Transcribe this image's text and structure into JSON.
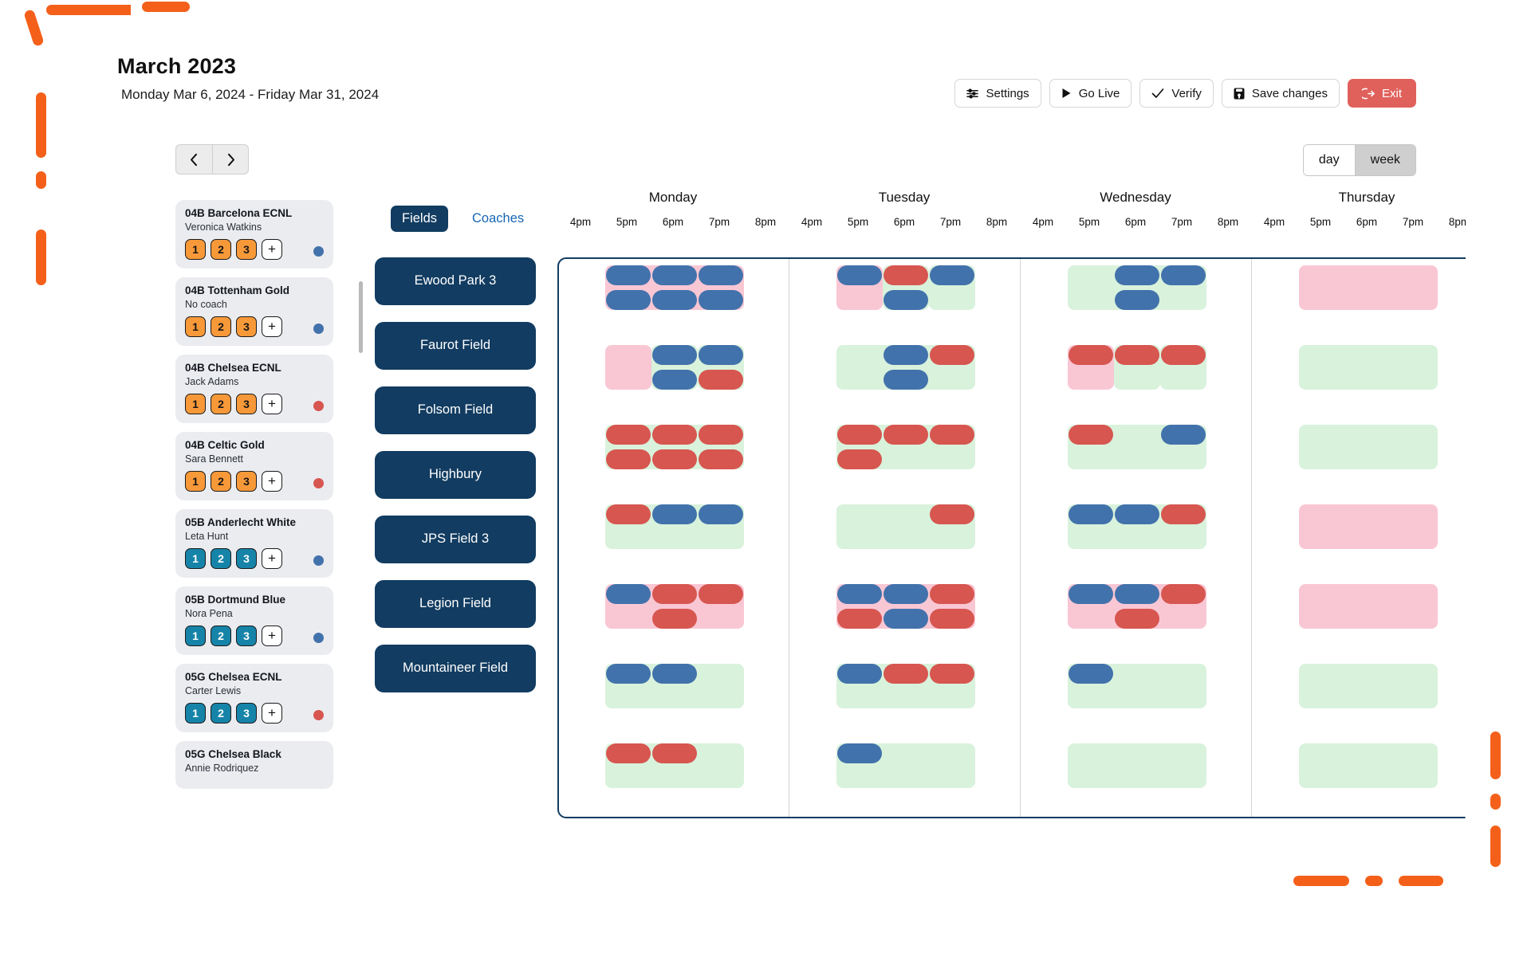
{
  "header": {
    "title": "March 2023",
    "date_range": "Monday Mar 6, 2024 - Friday Mar 31, 2024",
    "prev_icon": "chevron-left-icon",
    "next_icon": "chevron-right-icon"
  },
  "toolbar": {
    "settings_label": "Settings",
    "go_live_label": "Go Live",
    "verify_label": "Verify",
    "save_label": "Save changes",
    "exit_label": "Exit",
    "exit_color": "#e0615c"
  },
  "view_toggle": {
    "day_label": "day",
    "week_label": "week",
    "active": "week"
  },
  "panel_tabs": {
    "fields_label": "Fields",
    "coaches_label": "Coaches",
    "active": "Fields",
    "active_color": "#123c61",
    "link_color": "#1766b4"
  },
  "teams": [
    {
      "name": "04B Barcelona ECNL",
      "coach": "Veronica Watkins",
      "badges": [
        "1",
        "2",
        "3"
      ],
      "add_label": "+",
      "badge_style": "orange",
      "dot_color": "#4272ab"
    },
    {
      "name": "04B Tottenham Gold",
      "coach": "No coach",
      "badges": [
        "1",
        "2",
        "3"
      ],
      "add_label": "+",
      "badge_style": "orange",
      "dot_color": "#4272ab"
    },
    {
      "name": "04B Chelsea ECNL",
      "coach": "Jack Adams",
      "badges": [
        "1",
        "2",
        "3"
      ],
      "add_label": "+",
      "badge_style": "orange",
      "dot_color": "#d75650"
    },
    {
      "name": "04B Celtic Gold",
      "coach": "Sara Bennett",
      "badges": [
        "1",
        "2",
        "3"
      ],
      "add_label": "+",
      "badge_style": "orange",
      "dot_color": "#d75650"
    },
    {
      "name": "05B Anderlecht White",
      "coach": "Leta Hunt",
      "badges": [
        "1",
        "2",
        "3"
      ],
      "add_label": "+",
      "badge_style": "teal",
      "dot_color": "#4272ab"
    },
    {
      "name": "05B Dortmund Blue",
      "coach": "Nora Pena",
      "badges": [
        "1",
        "2",
        "3"
      ],
      "add_label": "+",
      "badge_style": "teal",
      "dot_color": "#4272ab"
    },
    {
      "name": "05G Chelsea ECNL",
      "coach": "Carter Lewis",
      "badges": [
        "1",
        "2",
        "3"
      ],
      "add_label": "+",
      "badge_style": "teal",
      "dot_color": "#d75650"
    },
    {
      "name": "05G Chelsea Black",
      "coach": "Annie Rodriquez",
      "badges": [],
      "add_label": "+",
      "badge_style": "teal",
      "dot_color": ""
    }
  ],
  "fields": [
    {
      "label": "Ewood Park 3"
    },
    {
      "label": "Faurot Field"
    },
    {
      "label": "Folsom Field"
    },
    {
      "label": "Highbury"
    },
    {
      "label": "JPS Field 3"
    },
    {
      "label": "Legion Field"
    },
    {
      "label": "Mountaineer Field"
    }
  ],
  "calendar": {
    "days": [
      "Monday",
      "Tuesday",
      "Wednesday",
      "Thursday"
    ],
    "hours": [
      "4pm",
      "5pm",
      "6pm",
      "7pm",
      "8pm"
    ],
    "border_color": "#123c61",
    "band_green": "#d9f2dc",
    "band_pink": "#f9c7d4",
    "event_blue": "#4272ab",
    "event_red": "#d75650",
    "rows": [
      {
        "field": "Ewood Park 3",
        "cells": [
          {
            "day": "Monday",
            "band": "pink",
            "start": 1,
            "span": 3,
            "events": [
              {
                "c": 0,
                "half": "top",
                "color": "blue"
              },
              {
                "c": 0,
                "half": "bottom",
                "color": "blue"
              },
              {
                "c": 1,
                "half": "top",
                "color": "blue"
              },
              {
                "c": 1,
                "half": "bottom",
                "color": "blue"
              },
              {
                "c": 2,
                "half": "top",
                "color": "blue"
              },
              {
                "c": 2,
                "half": "bottom",
                "color": "blue"
              }
            ]
          },
          {
            "day": "Tuesday",
            "band": "mixed",
            "start": 1,
            "span": 3,
            "bandsegs": [
              {
                "c": 0,
                "color": "pink"
              },
              {
                "c": 1,
                "color": "green"
              },
              {
                "c": 2,
                "color": "green"
              }
            ],
            "events": [
              {
                "c": 0,
                "half": "top",
                "color": "blue"
              },
              {
                "c": 1,
                "half": "top",
                "color": "red"
              },
              {
                "c": 1,
                "half": "bottom",
                "color": "blue"
              },
              {
                "c": 2,
                "half": "top",
                "color": "blue"
              }
            ]
          },
          {
            "day": "Wednesday",
            "band": "green",
            "start": 1,
            "span": 3,
            "events": [
              {
                "c": 1,
                "half": "top",
                "color": "blue"
              },
              {
                "c": 1,
                "half": "bottom",
                "color": "blue"
              },
              {
                "c": 2,
                "half": "top",
                "color": "blue"
              }
            ]
          },
          {
            "day": "Thursday",
            "band": "pink",
            "start": 1,
            "span": 3,
            "events": []
          }
        ]
      },
      {
        "field": "Faurot Field",
        "cells": [
          {
            "day": "Monday",
            "band": "mixed",
            "start": 1,
            "span": 3,
            "bandsegs": [
              {
                "c": 0,
                "color": "pink"
              },
              {
                "c": 1,
                "color": "green"
              },
              {
                "c": 2,
                "color": "green"
              }
            ],
            "events": [
              {
                "c": 1,
                "half": "top",
                "color": "blue"
              },
              {
                "c": 1,
                "half": "bottom",
                "color": "blue"
              },
              {
                "c": 2,
                "half": "top",
                "color": "blue"
              },
              {
                "c": 2,
                "half": "bottom",
                "color": "red"
              }
            ]
          },
          {
            "day": "Tuesday",
            "band": "green",
            "start": 1,
            "span": 3,
            "events": [
              {
                "c": 1,
                "half": "top",
                "color": "blue"
              },
              {
                "c": 1,
                "half": "bottom",
                "color": "blue"
              },
              {
                "c": 2,
                "half": "top",
                "color": "red"
              }
            ]
          },
          {
            "day": "Wednesday",
            "band": "mixed",
            "start": 1,
            "span": 3,
            "bandsegs": [
              {
                "c": 0,
                "color": "pink"
              },
              {
                "c": 1,
                "color": "green"
              },
              {
                "c": 2,
                "color": "green"
              }
            ],
            "events": [
              {
                "c": 0,
                "half": "top",
                "color": "red"
              },
              {
                "c": 1,
                "half": "top",
                "color": "red"
              },
              {
                "c": 2,
                "half": "top",
                "color": "red"
              }
            ]
          },
          {
            "day": "Thursday",
            "band": "green",
            "start": 1,
            "span": 3,
            "events": []
          }
        ]
      },
      {
        "field": "Folsom Field",
        "cells": [
          {
            "day": "Monday",
            "band": "green",
            "start": 1,
            "span": 3,
            "events": [
              {
                "c": 0,
                "half": "top",
                "color": "red"
              },
              {
                "c": 0,
                "half": "bottom",
                "color": "red"
              },
              {
                "c": 1,
                "half": "top",
                "color": "red"
              },
              {
                "c": 1,
                "half": "bottom",
                "color": "red"
              },
              {
                "c": 2,
                "half": "top",
                "color": "red"
              },
              {
                "c": 2,
                "half": "bottom",
                "color": "red"
              }
            ]
          },
          {
            "day": "Tuesday",
            "band": "green",
            "start": 1,
            "span": 3,
            "events": [
              {
                "c": 0,
                "half": "top",
                "color": "red"
              },
              {
                "c": 0,
                "half": "bottom",
                "color": "red"
              },
              {
                "c": 1,
                "half": "top",
                "color": "red"
              },
              {
                "c": 2,
                "half": "top",
                "color": "red"
              }
            ]
          },
          {
            "day": "Wednesday",
            "band": "green",
            "start": 1,
            "span": 3,
            "events": [
              {
                "c": 0,
                "half": "top",
                "color": "red"
              },
              {
                "c": 2,
                "half": "top",
                "color": "blue"
              }
            ]
          },
          {
            "day": "Thursday",
            "band": "green",
            "start": 1,
            "span": 3,
            "events": []
          }
        ]
      },
      {
        "field": "Highbury",
        "cells": [
          {
            "day": "Monday",
            "band": "green",
            "start": 1,
            "span": 3,
            "events": [
              {
                "c": 0,
                "half": "top",
                "color": "red"
              },
              {
                "c": 1,
                "half": "top",
                "color": "blue"
              },
              {
                "c": 2,
                "half": "top",
                "color": "blue"
              }
            ]
          },
          {
            "day": "Tuesday",
            "band": "green",
            "start": 1,
            "span": 3,
            "events": [
              {
                "c": 2,
                "half": "top",
                "color": "red"
              }
            ]
          },
          {
            "day": "Wednesday",
            "band": "green",
            "start": 1,
            "span": 3,
            "events": [
              {
                "c": 0,
                "half": "top",
                "color": "blue"
              },
              {
                "c": 1,
                "half": "top",
                "color": "blue"
              },
              {
                "c": 2,
                "half": "top",
                "color": "red"
              }
            ]
          },
          {
            "day": "Thursday",
            "band": "pink",
            "start": 1,
            "span": 3,
            "events": []
          }
        ]
      },
      {
        "field": "JPS Field 3",
        "cells": [
          {
            "day": "Monday",
            "band": "pink",
            "start": 1,
            "span": 3,
            "events": [
              {
                "c": 0,
                "half": "top",
                "color": "blue"
              },
              {
                "c": 1,
                "half": "top",
                "color": "red"
              },
              {
                "c": 1,
                "half": "bottom",
                "color": "red"
              },
              {
                "c": 2,
                "half": "top",
                "color": "red"
              }
            ]
          },
          {
            "day": "Tuesday",
            "band": "pink",
            "start": 1,
            "span": 3,
            "events": [
              {
                "c": 0,
                "half": "top",
                "color": "blue"
              },
              {
                "c": 0,
                "half": "bottom",
                "color": "red"
              },
              {
                "c": 1,
                "half": "top",
                "color": "blue"
              },
              {
                "c": 1,
                "half": "bottom",
                "color": "blue"
              },
              {
                "c": 2,
                "half": "top",
                "color": "red"
              },
              {
                "c": 2,
                "half": "bottom",
                "color": "red"
              }
            ]
          },
          {
            "day": "Wednesday",
            "band": "pink",
            "start": 1,
            "span": 3,
            "events": [
              {
                "c": 0,
                "half": "top",
                "color": "blue"
              },
              {
                "c": 1,
                "half": "top",
                "color": "blue"
              },
              {
                "c": 1,
                "half": "bottom",
                "color": "red"
              },
              {
                "c": 2,
                "half": "top",
                "color": "red"
              }
            ]
          },
          {
            "day": "Thursday",
            "band": "pink",
            "start": 1,
            "span": 3,
            "events": []
          }
        ]
      },
      {
        "field": "Legion Field",
        "cells": [
          {
            "day": "Monday",
            "band": "green",
            "start": 1,
            "span": 3,
            "events": [
              {
                "c": 0,
                "half": "top",
                "color": "blue"
              },
              {
                "c": 1,
                "half": "top",
                "color": "blue"
              }
            ]
          },
          {
            "day": "Tuesday",
            "band": "green",
            "start": 1,
            "span": 3,
            "events": [
              {
                "c": 0,
                "half": "top",
                "color": "blue"
              },
              {
                "c": 1,
                "half": "top",
                "color": "red"
              },
              {
                "c": 2,
                "half": "top",
                "color": "red"
              }
            ]
          },
          {
            "day": "Wednesday",
            "band": "green",
            "start": 1,
            "span": 3,
            "events": [
              {
                "c": 0,
                "half": "top",
                "color": "blue"
              }
            ]
          },
          {
            "day": "Thursday",
            "band": "green",
            "start": 1,
            "span": 3,
            "events": []
          }
        ]
      },
      {
        "field": "Mountaineer Field",
        "cells": [
          {
            "day": "Monday",
            "band": "green",
            "start": 1,
            "span": 3,
            "events": [
              {
                "c": 0,
                "half": "top",
                "color": "red"
              },
              {
                "c": 1,
                "half": "top",
                "color": "red"
              }
            ]
          },
          {
            "day": "Tuesday",
            "band": "green",
            "start": 1,
            "span": 3,
            "events": [
              {
                "c": 0,
                "half": "top",
                "color": "blue"
              }
            ]
          },
          {
            "day": "Wednesday",
            "band": "green",
            "start": 1,
            "span": 3,
            "events": []
          },
          {
            "day": "Thursday",
            "band": "green",
            "start": 1,
            "span": 3,
            "events": []
          }
        ]
      }
    ]
  }
}
